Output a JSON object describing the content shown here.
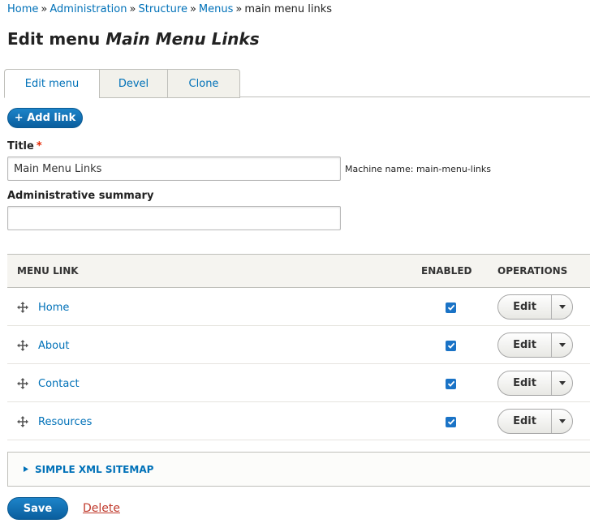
{
  "breadcrumb": {
    "items": [
      "Home",
      "Administration",
      "Structure",
      "Menus"
    ],
    "current": "main menu links",
    "separator": "»"
  },
  "page": {
    "title_prefix": "Edit menu",
    "title_name": "Main Menu Links"
  },
  "tabs": [
    "Edit menu",
    "Devel",
    "Clone"
  ],
  "add_link_label": "+ Add link",
  "form": {
    "title_label": "Title",
    "required_mark": "*",
    "title_value": "Main Menu Links",
    "machine_name": "Machine name: main-menu-links",
    "summary_label": "Administrative summary",
    "summary_value": ""
  },
  "table": {
    "headers": [
      "MENU LINK",
      "ENABLED",
      "OPERATIONS"
    ],
    "rows": [
      {
        "label": "Home",
        "enabled": true,
        "op": "Edit"
      },
      {
        "label": "About",
        "enabled": true,
        "op": "Edit"
      },
      {
        "label": "Contact",
        "enabled": true,
        "op": "Edit"
      },
      {
        "label": "Resources",
        "enabled": true,
        "op": "Edit"
      }
    ]
  },
  "details_label": "SIMPLE XML SITEMAP",
  "actions": {
    "save": "Save",
    "delete": "Delete"
  },
  "icons": {
    "drag": "drag-handle-icon",
    "check": "checkmark-icon",
    "dropdown": "caret-down-icon",
    "disclosure": "triangle-right-icon"
  },
  "colors": {
    "link": "#0071b8",
    "primary": "#0a6ab4",
    "required": "#e62600",
    "delete": "#c0392b",
    "checkbox": "#1a73c6"
  }
}
